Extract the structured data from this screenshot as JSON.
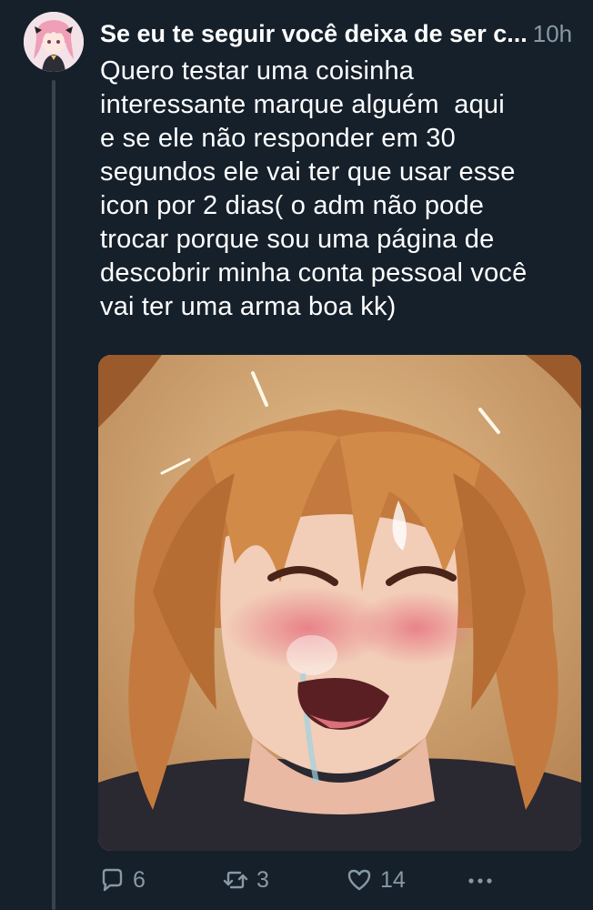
{
  "tweet": {
    "display_name": "Se eu te seguir você deixa de ser c...",
    "time": "10h",
    "text": "Quero testar uma coisinha\ninteressante marque alguém  aqui\ne se ele não responder em 30\nsegundos ele vai ter que usar esse\nicon por 2 dias( o adm não pode\ntrocar porque sou uma página de\ndescobrir minha conta pessoal você\nvai ter uma arma boa kk)"
  },
  "actions": {
    "reply_count": "6",
    "retweet_count": "3",
    "like_count": "14",
    "reply_icon": "reply-icon",
    "retweet_icon": "retweet-icon",
    "like_icon": "heart-icon",
    "more_icon": "more-icon"
  },
  "colors": {
    "background": "#15202b",
    "text_primary": "#ffffff",
    "text_secondary": "#8899a6",
    "thread_line": "#38444d"
  }
}
